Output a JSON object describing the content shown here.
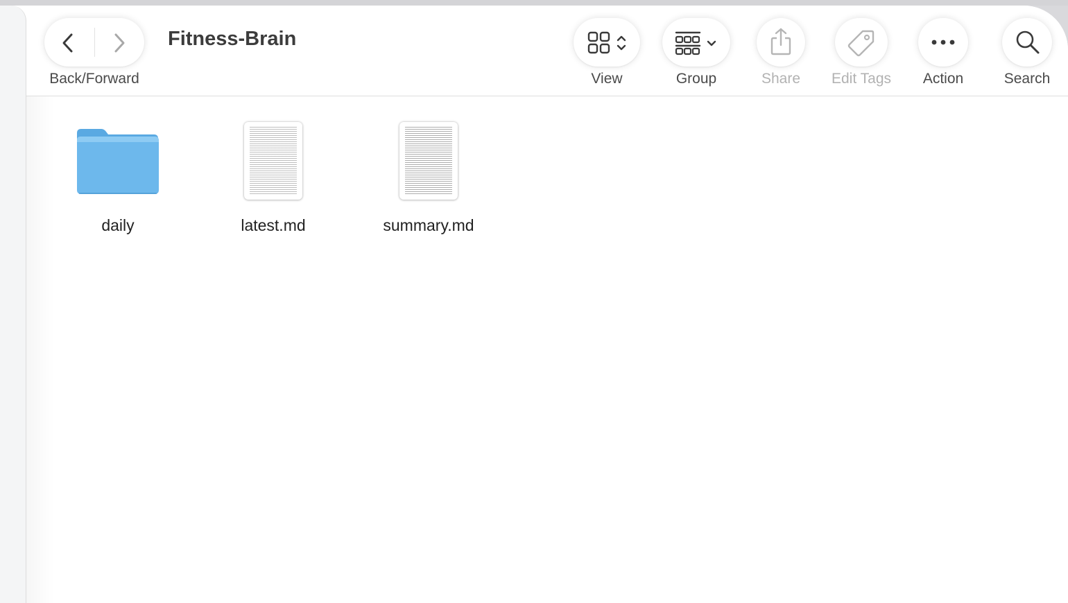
{
  "window": {
    "title": "Fitness-Brain"
  },
  "toolbar": {
    "back_forward_label": "Back/Forward",
    "view_label": "View",
    "group_label": "Group",
    "share_label": "Share",
    "edit_tags_label": "Edit Tags",
    "action_label": "Action",
    "search_label": "Search"
  },
  "files": [
    {
      "name": "daily",
      "kind": "folder-icon"
    },
    {
      "name": "latest.md",
      "kind": "markdown-document-icon"
    },
    {
      "name": "summary.md",
      "kind": "markdown-document-icon"
    }
  ],
  "colors": {
    "folder_blue": "#6db8ec",
    "label_text": "#4a4a4a",
    "disabled_label_text": "#b2b2b2"
  }
}
